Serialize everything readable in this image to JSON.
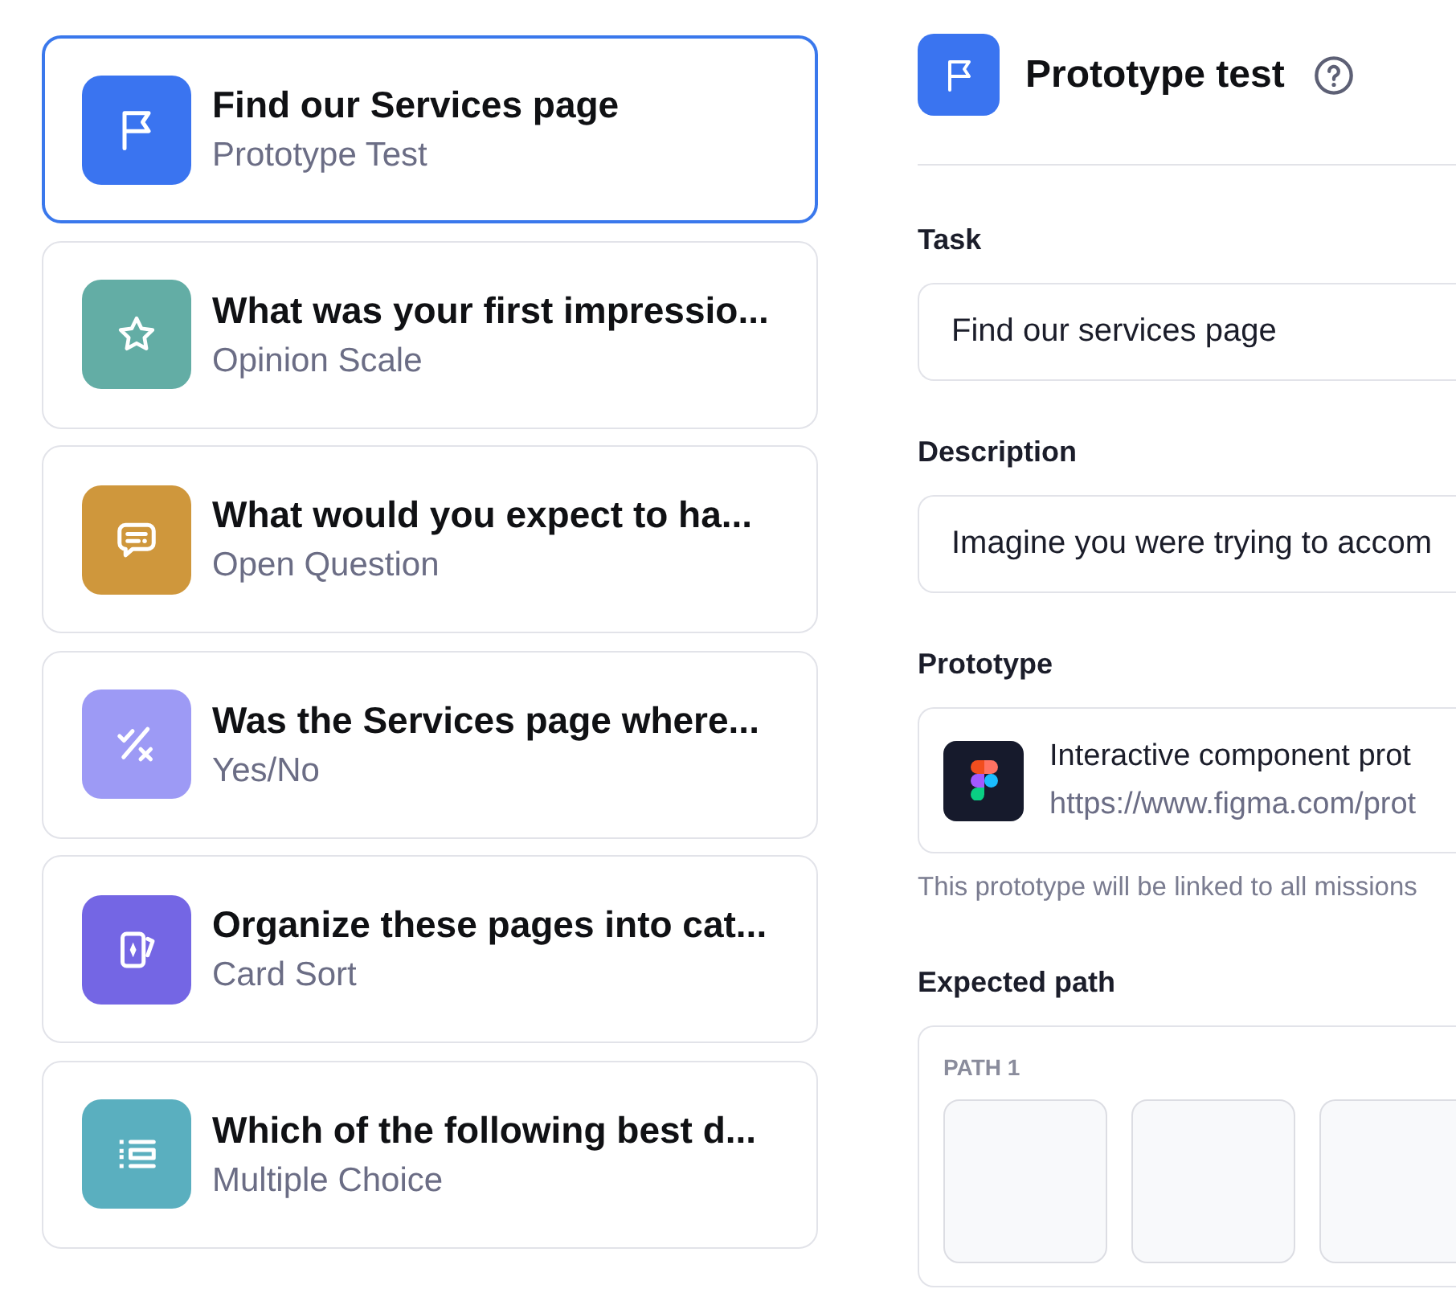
{
  "questions": [
    {
      "kind": "prototype_test",
      "title": "Find our Services page",
      "type": "Prototype Test",
      "color": "#3a74f0",
      "selected": true
    },
    {
      "kind": "opinion_scale",
      "title": "What was your first impressio...",
      "type": "Opinion Scale",
      "color": "#63ada5",
      "selected": false
    },
    {
      "kind": "open_question",
      "title": "What would you expect to ha...",
      "type": "Open Question",
      "color": "#cf973c",
      "selected": false
    },
    {
      "kind": "yes_no",
      "title": "Was the Services page where...",
      "type": "Yes/No",
      "color": "#9d9af5",
      "selected": false
    },
    {
      "kind": "card_sort",
      "title": "Organize these pages into cat...",
      "type": "Card Sort",
      "color": "#7466e4",
      "selected": false
    },
    {
      "kind": "multiple_choice",
      "title": "Which of the following best d...",
      "type": "Multiple Choice",
      "color": "#5aafbf",
      "selected": false
    }
  ],
  "editor": {
    "kind": "prototype_test",
    "color": "#3a74f0",
    "title": "Prototype test",
    "task": {
      "label": "Task",
      "value": "Find our services page"
    },
    "description": {
      "label": "Description",
      "value": "Imagine you were trying to accom"
    },
    "prototype": {
      "label": "Prototype",
      "name": "Interactive component prot",
      "url": "https://www.figma.com/prot",
      "note": "This prototype will be linked to all missions"
    },
    "expected_path": {
      "label": "Expected path",
      "paths": [
        {
          "label": "PATH 1",
          "steps": [
            {
              "empty": true
            },
            {
              "empty": true
            },
            {
              "empty": true
            }
          ]
        }
      ]
    }
  }
}
